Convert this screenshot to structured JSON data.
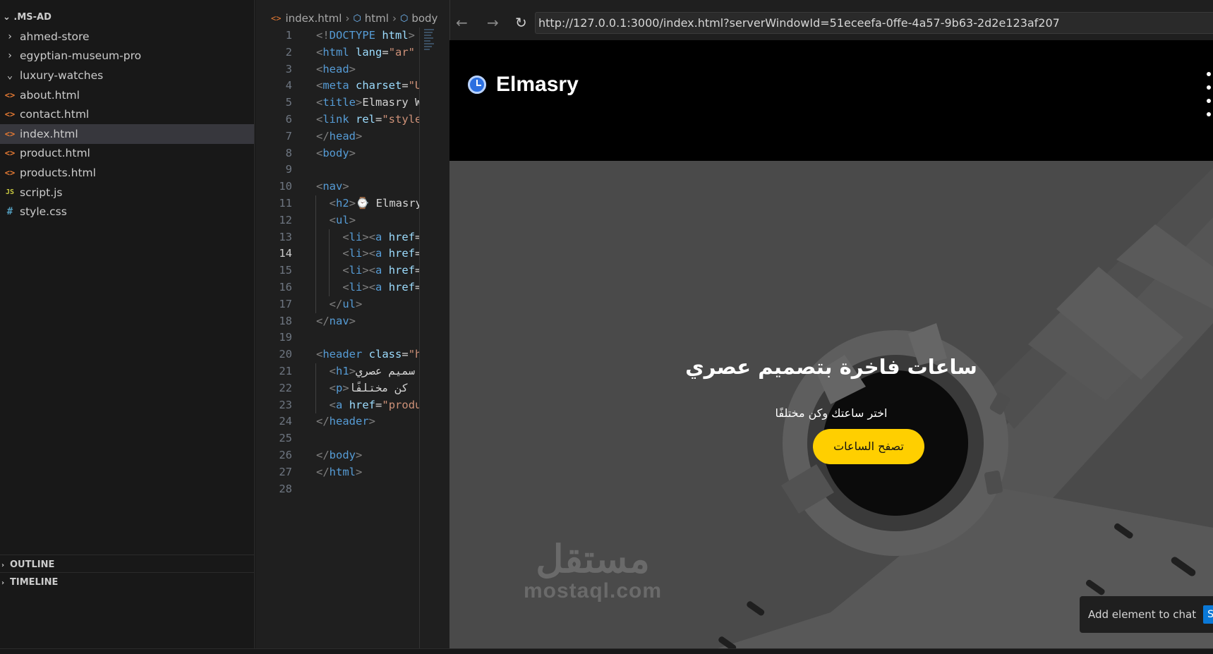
{
  "explorer": {
    "root": ".MS-AD",
    "items": [
      {
        "label": "ahmed-store",
        "icon": "chevron-right-icon",
        "glyph": "›"
      },
      {
        "label": "egyptian-museum-pro",
        "icon": "chevron-right-icon",
        "glyph": "›"
      },
      {
        "label": "luxury-watches",
        "icon": "chevron-down-icon",
        "glyph": "⌄"
      },
      {
        "label": "about.html",
        "icon": "html-file-icon",
        "glyph": "<>"
      },
      {
        "label": "contact.html",
        "icon": "html-file-icon",
        "glyph": "<>"
      },
      {
        "label": "index.html",
        "icon": "html-file-icon",
        "glyph": "<>",
        "active": true
      },
      {
        "label": "product.html",
        "icon": "html-file-icon",
        "glyph": "<>"
      },
      {
        "label": "products.html",
        "icon": "html-file-icon",
        "glyph": "<>"
      },
      {
        "label": "script.js",
        "icon": "js-file-icon",
        "glyph": "JS"
      },
      {
        "label": "style.css",
        "icon": "css-file-icon",
        "glyph": "#"
      }
    ],
    "outline": "OUTLINE",
    "timeline": "TIMELINE"
  },
  "editor": {
    "breadcrumb": [
      "index.html",
      "html",
      "body"
    ],
    "current_line": 14,
    "lines": [
      {
        "n": 1,
        "text": "<!DOCTYPE html>"
      },
      {
        "n": 2,
        "text": "<html lang=\"ar\""
      },
      {
        "n": 3,
        "text": "<head>"
      },
      {
        "n": 4,
        "text": "<meta charset=\"U"
      },
      {
        "n": 5,
        "text": "<title>Elmasry W"
      },
      {
        "n": 6,
        "text": "<link rel=\"style"
      },
      {
        "n": 7,
        "text": "</head>"
      },
      {
        "n": 8,
        "text": "<body>"
      },
      {
        "n": 9,
        "text": ""
      },
      {
        "n": 10,
        "text": "<nav>"
      },
      {
        "n": 11,
        "text": "  <h2>⌚ Elmasry"
      },
      {
        "n": 12,
        "text": "  <ul>"
      },
      {
        "n": 13,
        "text": "    <li><a href="
      },
      {
        "n": 14,
        "text": "    <li><a href="
      },
      {
        "n": 15,
        "text": "    <li><a href="
      },
      {
        "n": 16,
        "text": "    <li><a href="
      },
      {
        "n": 17,
        "text": "  </ul>"
      },
      {
        "n": 18,
        "text": "</nav>"
      },
      {
        "n": 19,
        "text": ""
      },
      {
        "n": 20,
        "text": "<header class=\"h"
      },
      {
        "n": 21,
        "text": "  <h1>سميم عصري"
      },
      {
        "n": 22,
        "text": "  <p>كن مختلفًا"
      },
      {
        "n": 23,
        "text": "  <a href=\"produ"
      },
      {
        "n": 24,
        "text": "</header>"
      },
      {
        "n": 25,
        "text": ""
      },
      {
        "n": 26,
        "text": "</body>"
      },
      {
        "n": 27,
        "text": "</html>"
      },
      {
        "n": 28,
        "text": ""
      }
    ]
  },
  "browser": {
    "back_icon": "←",
    "forward_icon": "→",
    "reload_icon": "↻",
    "url": "http://127.0.0.1:3000/index.html?serverWindowId=51eceefa-0ffe-4a57-9b63-2d2e123af207",
    "site": {
      "brand": "Elmasry",
      "hero_title": "ساعات فاخرة بتصميم عصري",
      "hero_subtitle": "اختر ساعتك وكن مختلفًا",
      "hero_button": "تصفح الساعات",
      "accent_color": "#ffcf00"
    },
    "watermark": {
      "arabic": "مستقل",
      "latin": "mostaql.com"
    },
    "add_element": {
      "label": "Add element to chat",
      "start": "Star"
    }
  }
}
